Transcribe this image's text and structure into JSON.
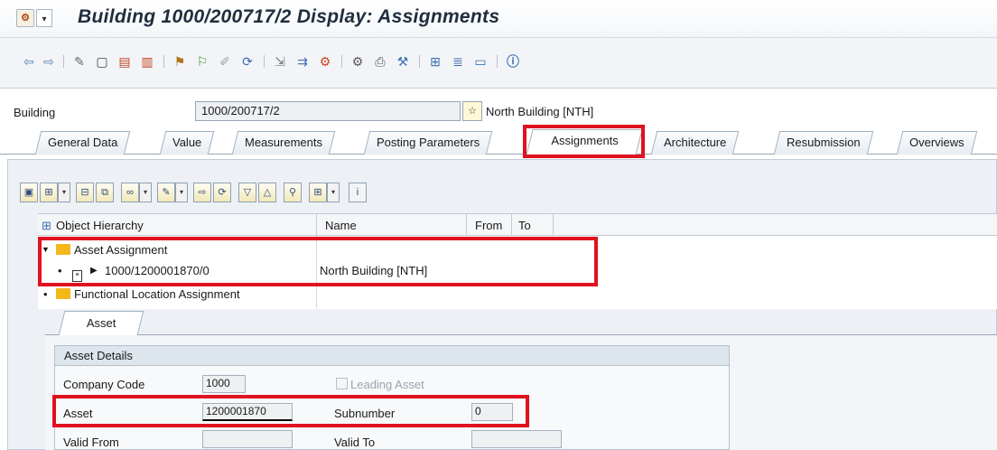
{
  "window": {
    "title": "Building 1000/200717/2 Display: Assignments"
  },
  "header": {
    "building_label": "Building",
    "building_value": "1000/200717/2",
    "building_desc": "North Building [NTH]"
  },
  "tabs": [
    {
      "label": "General Data"
    },
    {
      "label": "Value"
    },
    {
      "label": "Measurements"
    },
    {
      "label": "Posting Parameters"
    },
    {
      "label": "Assignments"
    },
    {
      "label": "Architecture"
    },
    {
      "label": "Resubmission"
    },
    {
      "label": "Overviews"
    }
  ],
  "active_tab": "Assignments",
  "tree": {
    "columns": [
      "Object Hierarchy",
      "Name",
      "From",
      "To"
    ],
    "rows": [
      {
        "label": "Asset Assignment",
        "name": "",
        "expanded": true
      },
      {
        "label": "1000/1200001870/0",
        "name": "North Building [NTH]"
      },
      {
        "label": "Functional Location Assignment",
        "name": ""
      }
    ]
  },
  "subtab": {
    "label": "Asset"
  },
  "asset_details": {
    "title": "Asset Details",
    "company_code_label": "Company Code",
    "company_code_value": "1000",
    "leading_asset_label": "Leading Asset",
    "leading_asset_checked": false,
    "asset_label": "Asset",
    "asset_value": "1200001870",
    "subnumber_label": "Subnumber",
    "subnumber_value": "0",
    "valid_from_label": "Valid From",
    "valid_from_value": "",
    "valid_to_label": "Valid To",
    "valid_to_value": ""
  },
  "colors": {
    "highlight": "#e0121f",
    "folder": "#f4b71a",
    "panel": "#edf1f5"
  }
}
